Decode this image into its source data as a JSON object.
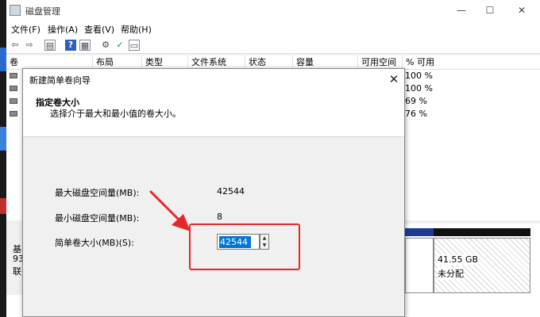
{
  "window": {
    "title": "磁盘管理",
    "controls": {
      "minimize": "—",
      "maximize": "☐",
      "close": "✕"
    }
  },
  "menu": [
    "文件(F)",
    "操作(A)",
    "查看(V)",
    "帮助(H)"
  ],
  "toolbar_icons": [
    "back-icon",
    "forward-icon",
    "list-view-icon",
    "help-icon",
    "properties-icon",
    "check-icon",
    "settings-icon"
  ],
  "volume_columns": [
    "卷",
    "布局",
    "类型",
    "文件系统",
    "状态",
    "容量",
    "可用空间",
    "% 可用"
  ],
  "volume_rows": [
    {
      "pct": "100 %"
    },
    {
      "pct": "100 %"
    },
    {
      "pct": "69 %"
    },
    {
      "pct": "76 %"
    }
  ],
  "disk": {
    "label_lines": [
      "基",
      "93",
      "联"
    ],
    "unallocated_size": "41.55 GB",
    "unallocated_status": "未分配"
  },
  "dialog": {
    "title": "新建简单卷向导",
    "close": "✕",
    "heading": "指定卷大小",
    "subheading": "选择介于最大和最小值的卷大小。",
    "max_label": "最大磁盘空间量(MB):",
    "max_value": "42544",
    "min_label": "最小磁盘空间量(MB):",
    "min_value": "8",
    "size_label": "简单卷大小(MB)(S):",
    "size_value": "42544",
    "spin_up": "▲",
    "spin_down": "▼"
  },
  "colors": {
    "annotation_red": "#e8262a",
    "selection_blue": "#0078d7",
    "partition_blue": "#1f3a93"
  }
}
